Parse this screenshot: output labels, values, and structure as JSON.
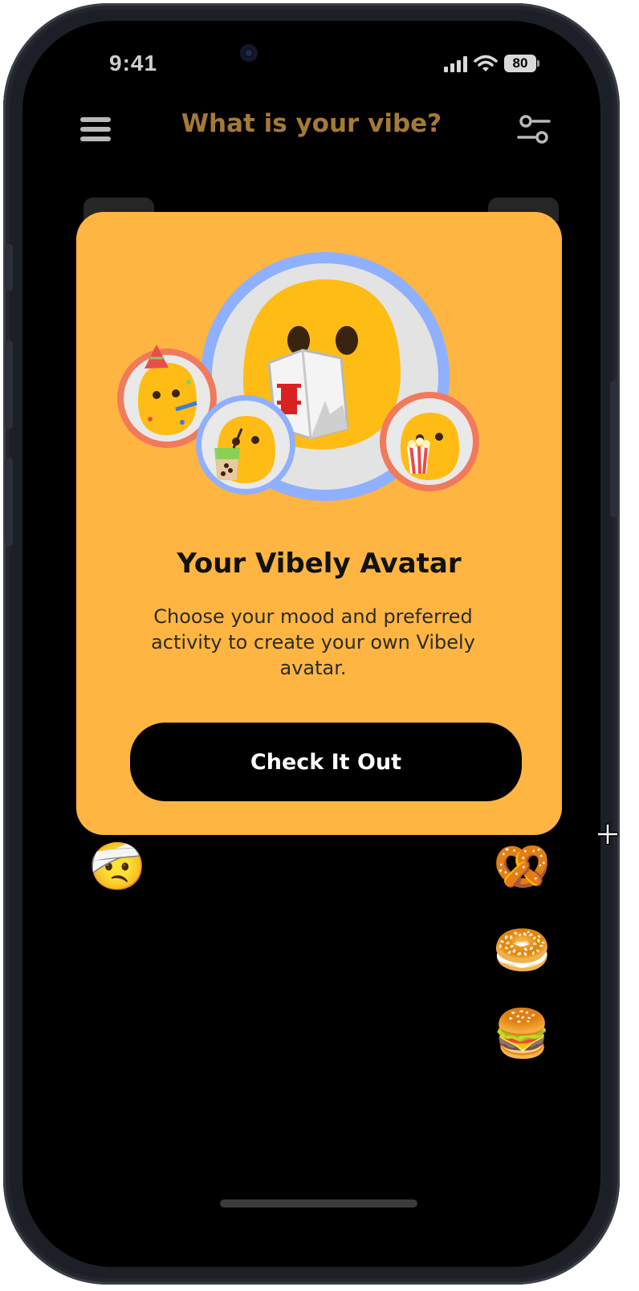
{
  "status": {
    "time": "9:41",
    "battery": "80"
  },
  "header": {
    "title": "What is your vibe?"
  },
  "modal": {
    "title": "Your Vibely Avatar",
    "description": "Choose your mood and preferred activity to create your own Vibely avatar.",
    "button_label": "Check It Out"
  },
  "moods": [
    "🤕",
    "😎",
    "😅"
  ],
  "foods": [
    "🥨",
    "🥯",
    "🍔"
  ],
  "colors": {
    "accent": "#ffb541",
    "title": "#a57a36",
    "background": "#000000"
  }
}
